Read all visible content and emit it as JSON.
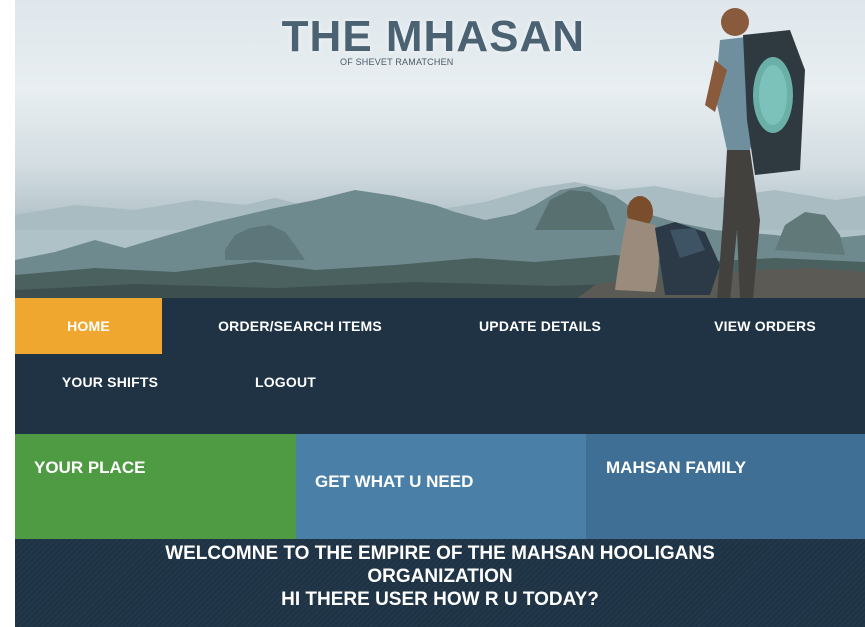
{
  "site": {
    "title": "THE MHASAN",
    "subtitle": "OF SHEVET RAMATCHEN"
  },
  "nav": {
    "items": [
      {
        "label": "HOME",
        "active": true
      },
      {
        "label": "ORDER/SEARCH ITEMS",
        "active": false
      },
      {
        "label": "UPDATE DETAILS",
        "active": false
      },
      {
        "label": "VIEW ORDERS",
        "active": false
      },
      {
        "label": "YOUR SHIFTS",
        "active": false
      },
      {
        "label": "LOGOUT",
        "active": false
      }
    ]
  },
  "boxes": [
    {
      "label": "YOUR PLACE",
      "color": "#4f9b43"
    },
    {
      "label": "GET WHAT U NEED",
      "color": "#4a80a8"
    },
    {
      "label": "MAHSAN FAMILY",
      "color": "#3f6f95"
    }
  ],
  "welcome": {
    "line1": "WELCOMNE TO THE EMPIRE OF THE MAHSAN HOOLIGANS",
    "line2": "ORGANIZATION",
    "line3": "HI THERE USER HOW R U TODAY?"
  },
  "colors": {
    "nav_bg": "#1f3344",
    "active_nav": "#f0a730"
  }
}
